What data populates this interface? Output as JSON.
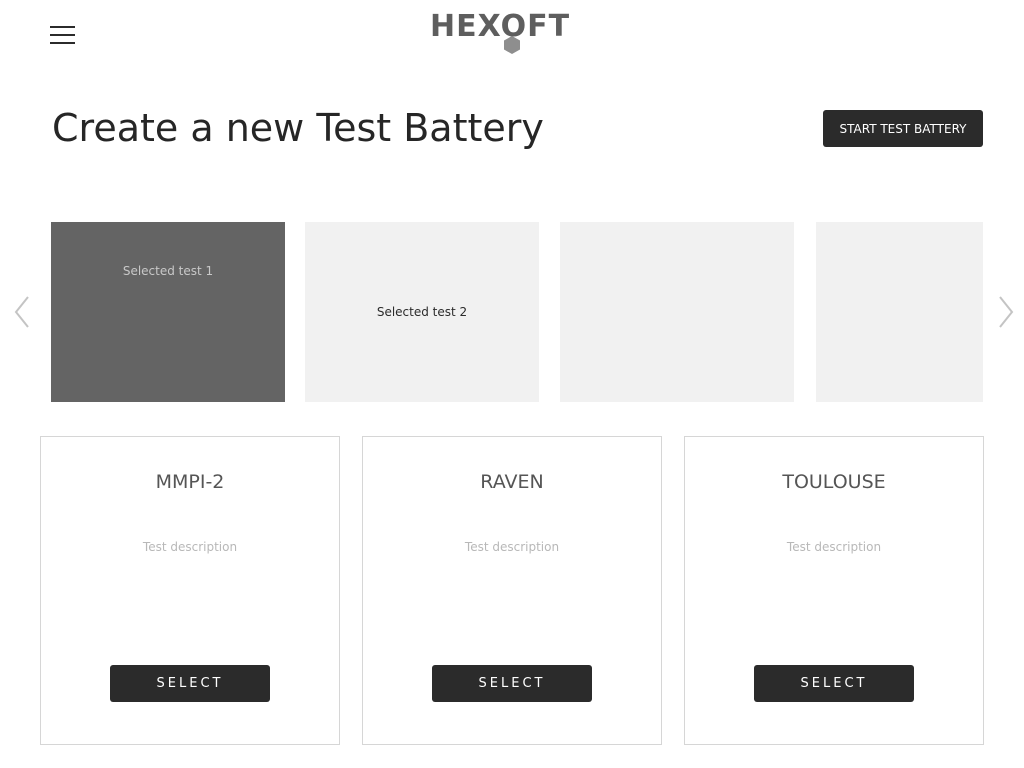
{
  "header": {
    "menu_icon": "hamburger-menu-icon",
    "logo_text": "HEXOFT",
    "logo_color": "#5e5e5e"
  },
  "page": {
    "title": "Create a new Test Battery",
    "start_button_label": "START TEST BATTERY"
  },
  "carousel": {
    "prev_icon": "chevron-left-icon",
    "next_icon": "chevron-right-icon",
    "slides": [
      {
        "label": "Selected test 1",
        "selected": true
      },
      {
        "label": "Selected test 2",
        "selected": false
      },
      {
        "label": "",
        "selected": false
      },
      {
        "label": "",
        "selected": false
      }
    ]
  },
  "tests": [
    {
      "name": "MMPI-2",
      "description": "Test description",
      "button_label": "SELECT"
    },
    {
      "name": "RAVEN",
      "description": "Test description",
      "button_label": "SELECT"
    },
    {
      "name": "TOULOUSE",
      "description": "Test description",
      "button_label": "SELECT"
    }
  ],
  "colors": {
    "primary_dark": "#2b2b2b",
    "selected_slide": "#646464",
    "empty_slide": "#f1f1f1",
    "card_border": "#d6d6d6"
  }
}
